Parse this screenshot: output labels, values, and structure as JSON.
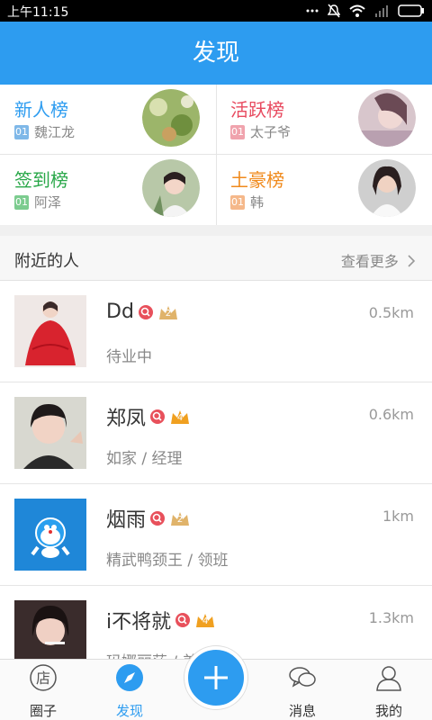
{
  "status": {
    "time": "上午11:15"
  },
  "title": "发现",
  "ranks": [
    {
      "title": "新人榜",
      "color": "#2d9cf0",
      "rank": "01",
      "name": "魏江龙"
    },
    {
      "title": "活跃榜",
      "color": "#e84a5f",
      "rank": "01",
      "name": "太子爷"
    },
    {
      "title": "签到榜",
      "color": "#2aa84a",
      "rank": "01",
      "name": "阿泽"
    },
    {
      "title": "土豪榜",
      "color": "#f08a1c",
      "rank": "01",
      "name": "韩"
    }
  ],
  "nearby": {
    "title": "附近的人",
    "more": "查看更多"
  },
  "people": [
    {
      "name": "Dd",
      "level": "2",
      "distance": "0.5km",
      "info": "待业中"
    },
    {
      "name": "郑凤",
      "level": "4",
      "distance": "0.6km",
      "info": "如家 / 经理"
    },
    {
      "name": "烟雨",
      "level": "2",
      "distance": "1km",
      "info": "精武鸭颈王 / 领班"
    },
    {
      "name": "i不将就",
      "level": "4",
      "distance": "1.3km",
      "info": "玛娜丽莎 / 美"
    }
  ],
  "tabs": [
    {
      "label": "圈子",
      "icon": "shop-icon"
    },
    {
      "label": "发现",
      "icon": "compass-icon"
    },
    {
      "label": "",
      "icon": "plus-icon"
    },
    {
      "label": "消息",
      "icon": "chat-icon"
    },
    {
      "label": "我的",
      "icon": "person-icon"
    }
  ],
  "colors": {
    "accent": "#2d9cf0"
  }
}
